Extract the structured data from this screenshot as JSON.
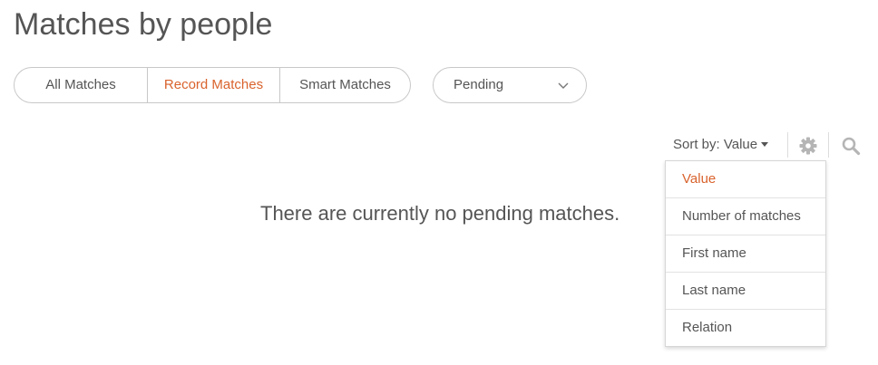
{
  "page": {
    "title": "Matches by people"
  },
  "tabs": [
    {
      "label": "All Matches",
      "active": false
    },
    {
      "label": "Record Matches",
      "active": true
    },
    {
      "label": "Smart Matches",
      "active": false
    }
  ],
  "status_filter": {
    "value": "Pending",
    "icon": "chevron-down-icon"
  },
  "toolbar": {
    "sort_label": "Sort by: Value",
    "settings_icon": "gear-icon",
    "search_icon": "search-icon"
  },
  "empty_state": {
    "message": "There are currently no pending matches."
  },
  "sort_menu": {
    "items": [
      {
        "label": "Value",
        "selected": true
      },
      {
        "label": "Number of matches",
        "selected": false
      },
      {
        "label": "First name",
        "selected": false
      },
      {
        "label": "Last name",
        "selected": false
      },
      {
        "label": "Relation",
        "selected": false
      }
    ]
  },
  "colors": {
    "accent": "#d9632d",
    "text": "#555555",
    "border": "#c8c8c8",
    "icon": "#b5b5b5"
  }
}
